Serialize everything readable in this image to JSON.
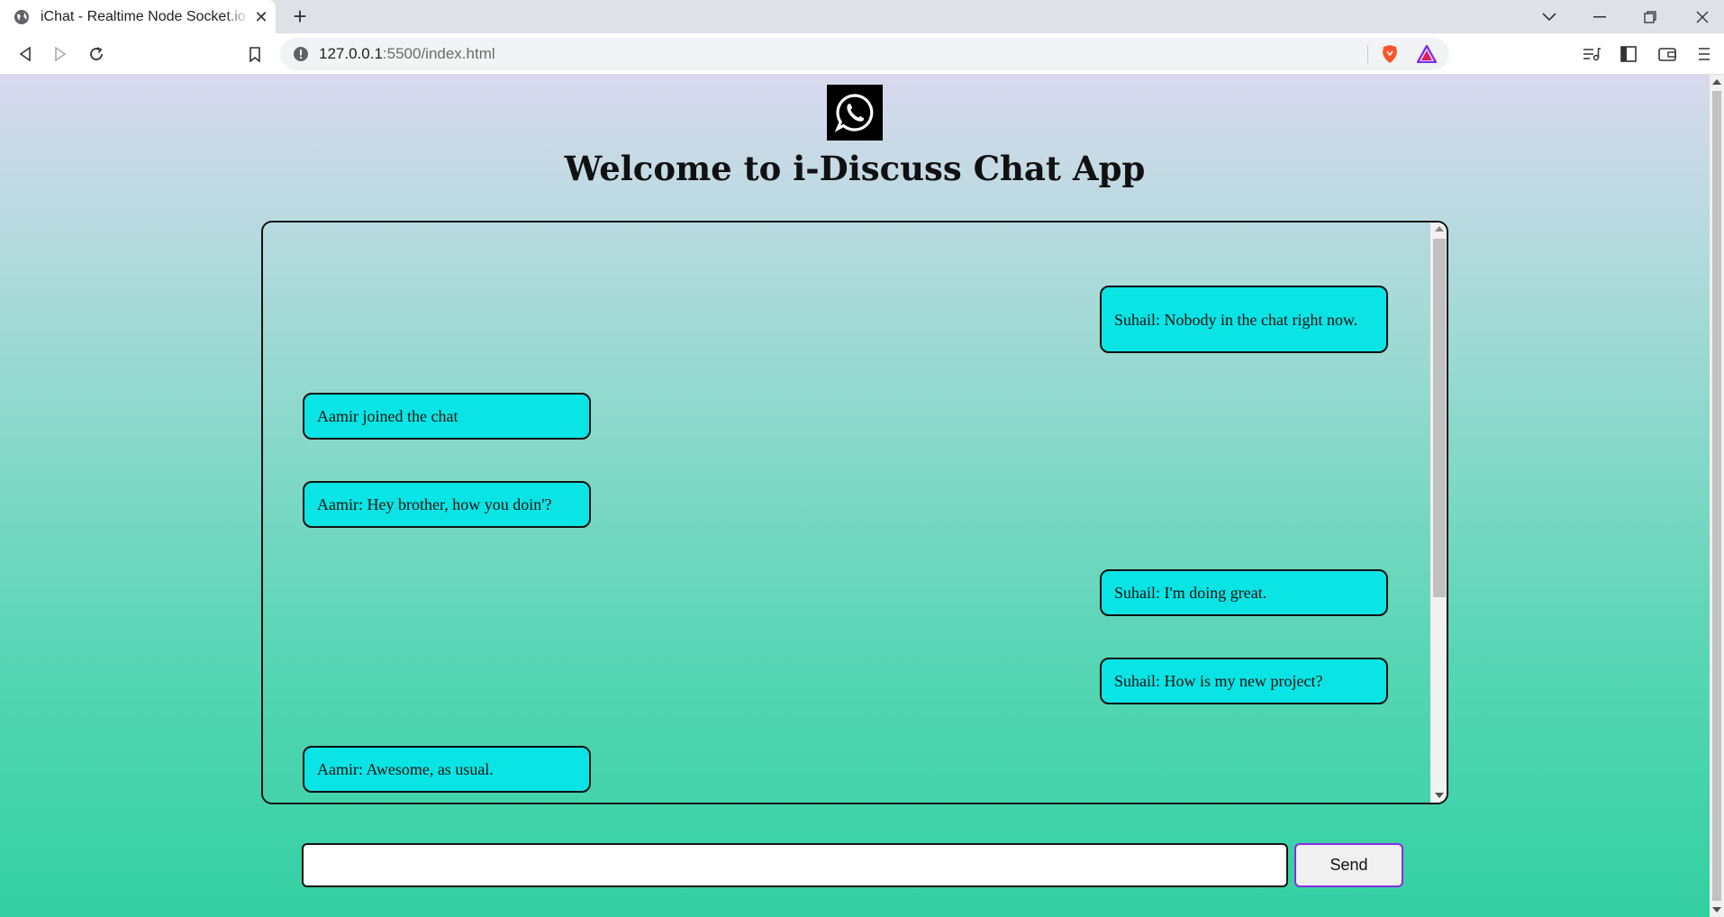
{
  "browser": {
    "tab_title": "iChat - Realtime Node Socket.io Chat",
    "url_host": "127.0.0.1",
    "url_rest": ":5500/index.html"
  },
  "page": {
    "heading": "Welcome to i-Discuss Chat App",
    "logo_icon": "whatsapp-icon"
  },
  "messages": [
    {
      "side": "right",
      "text": "Suhail: Nobody in the chat right now."
    },
    {
      "side": "left",
      "text": "Aamir joined the chat"
    },
    {
      "side": "left",
      "text": "Aamir: Hey brother, how you doin'?"
    },
    {
      "side": "right",
      "text": "Suhail: I'm doing great."
    },
    {
      "side": "right",
      "text": "Suhail: How is my new project?"
    },
    {
      "side": "left",
      "text": "Aamir: Awesome, as usual."
    }
  ],
  "composer": {
    "input_value": "",
    "input_placeholder": "",
    "send_label": "Send"
  },
  "colors": {
    "bubble": "#0ae4e4",
    "gradient_top": "#d9d9ee",
    "gradient_bottom": "#33d0a2",
    "send_border": "#8a2be2"
  }
}
